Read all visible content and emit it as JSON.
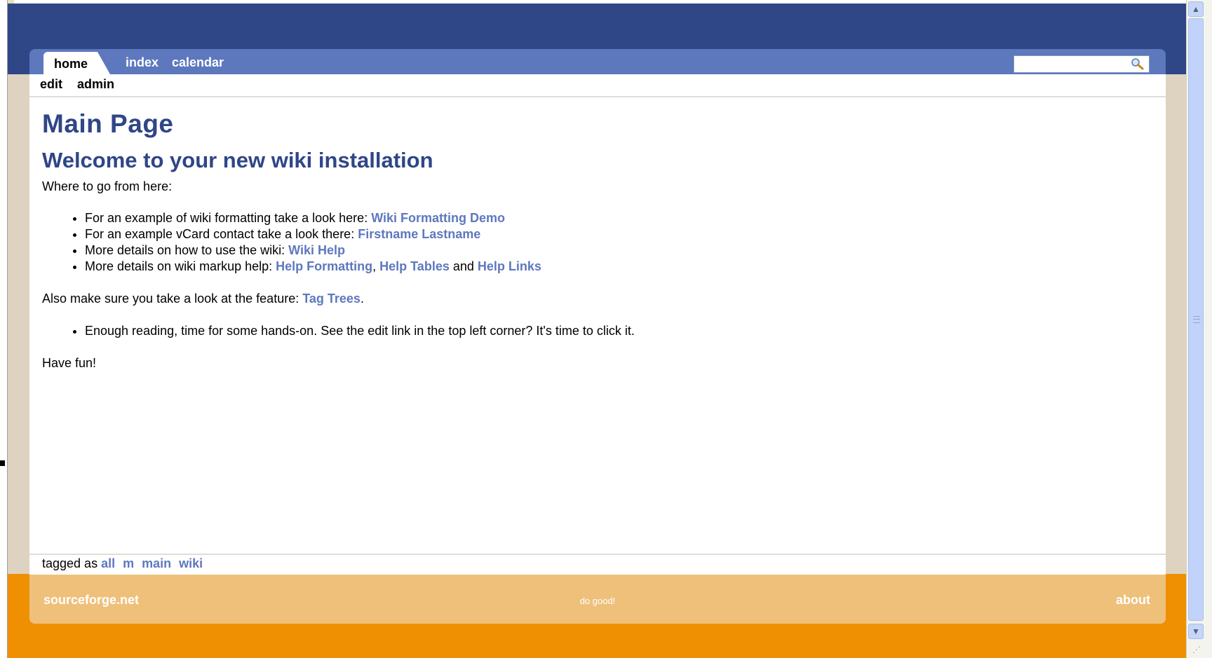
{
  "colors": {
    "header_blue": "#2f4687",
    "tab_bar_blue": "#5e78be",
    "sidebar_beige": "#ded3c0",
    "footer_orange": "#ee9002",
    "footer_panel": "#eec07a",
    "link": "#5e78be"
  },
  "tabs": {
    "home": "home",
    "index": "index",
    "calendar": "calendar"
  },
  "search": {
    "value": "",
    "icon": "search-icon"
  },
  "subnav": {
    "edit": "edit",
    "admin": "admin"
  },
  "page": {
    "title": "Main Page",
    "heading": "Welcome to your new wiki installation",
    "lead": "Where to go from here:",
    "items": [
      {
        "text": "For an example of wiki formatting take a look here: ",
        "links": [
          "Wiki Formatting Demo"
        ]
      },
      {
        "text": "For an example vCard contact take a look there: ",
        "links": [
          "Firstname Lastname"
        ]
      },
      {
        "text": "More details on how to use the wiki: ",
        "links": [
          "Wiki Help"
        ]
      },
      {
        "text": "More details on wiki markup help: ",
        "links": [
          "Help Formatting",
          "Help Tables",
          "Help Links"
        ],
        "sep1": ", ",
        "sep2": " and "
      }
    ],
    "also_text": "Also make sure you take a look at the feature: ",
    "also_link": "Tag Trees",
    "also_end": ".",
    "handson": "Enough reading, time for some hands-on. See the edit link in the top left corner? It's time to click it.",
    "fun": "Have fun!"
  },
  "tags": {
    "label": "tagged as ",
    "items": [
      "all",
      "m",
      "main",
      "wiki"
    ]
  },
  "footer": {
    "left": "sourceforge.net",
    "middle": "do good!",
    "right": "about"
  }
}
